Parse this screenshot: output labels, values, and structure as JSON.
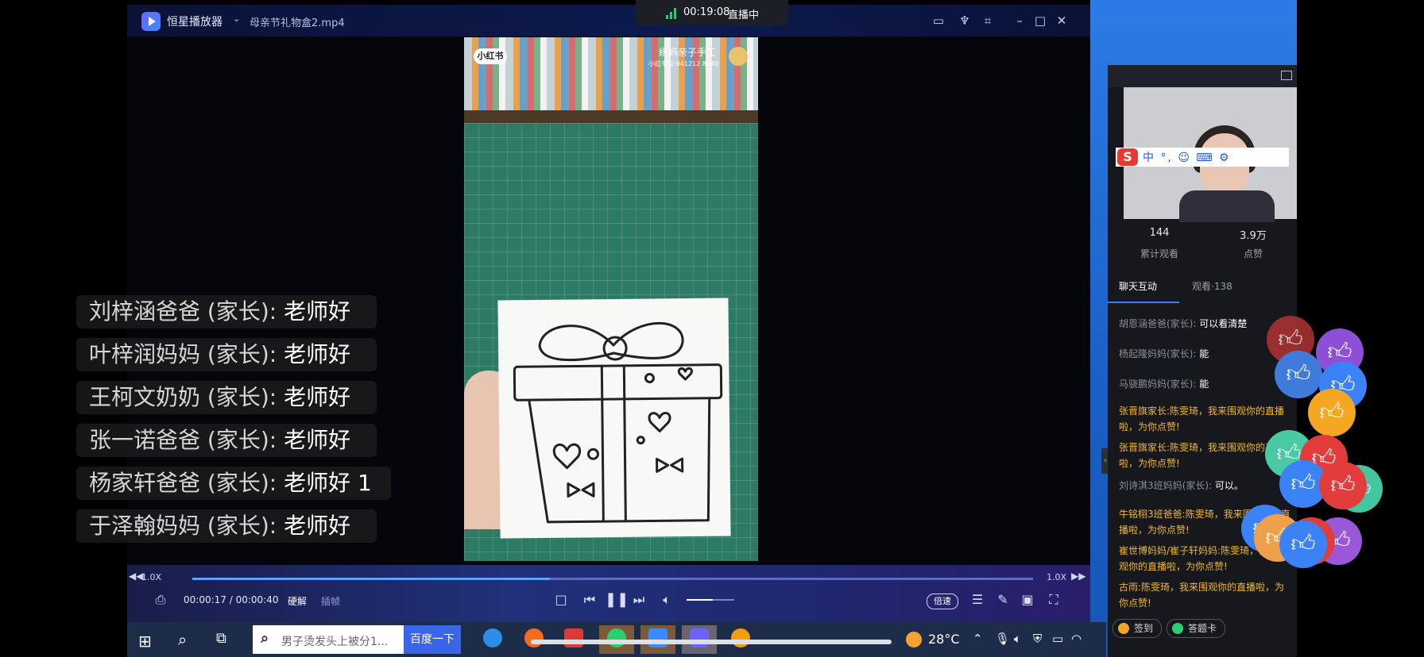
{
  "player": {
    "app_name": "恒星播放器",
    "file_name": "母亲节礼物盒2.mp4",
    "speed_left": "1.0X",
    "speed_right": "1.0X",
    "time": "00:00:17 / 00:00:40",
    "quality": "硬解",
    "plugin": "插帧",
    "rate_button": "倍速",
    "progress": 0.425,
    "volume": 0.55
  },
  "live_badge": {
    "time": "00:19:08",
    "label": "直播中"
  },
  "video": {
    "watermark_logo": "小红书",
    "watermark_name": "缘妈亲子手工",
    "watermark_id": "小红书号:941212 8840"
  },
  "danmaku": [
    {
      "who": "刘梓涵爸爸 (家长): ",
      "text": "老师好"
    },
    {
      "who": "叶梓润妈妈 (家长): ",
      "text": "老师好"
    },
    {
      "who": "王柯文奶奶 (家长): ",
      "text": "老师好"
    },
    {
      "who": "张一诺爸爸 (家长): ",
      "text": "老师好"
    },
    {
      "who": "杨家轩爸爸 (家长): ",
      "text": "老师好 1"
    },
    {
      "who": "于泽翰妈妈 (家长): ",
      "text": "老师好"
    }
  ],
  "ime": {
    "text": "中 °, ☺ ⌨ ⚙"
  },
  "stats": {
    "views": "144",
    "views_label": "累计观看",
    "likes": "3.9万",
    "likes_label": "点赞"
  },
  "tabs": {
    "chat": "聊天互动",
    "watch": "观看·138"
  },
  "chat": [
    {
      "name": "胡恩涵爸爸(家长):",
      "text": "可以看清楚",
      "hl": false
    },
    {
      "name": "杨起隆妈妈(家长):",
      "text": "能",
      "hl": false
    },
    {
      "name": "马骁鹏妈妈(家长):",
      "text": "能",
      "hl": false
    },
    {
      "name": "张晋旗家长:",
      "text": "陈雯琦，我来围观你的直播啦，为你点赞!",
      "hl": true
    },
    {
      "name": "张晋旗家长:",
      "text": "陈雯琦，我来围观你的直播啦，为你点赞!",
      "hl": true
    },
    {
      "name": "刘诗淇3班妈妈(家长):",
      "text": "可以。",
      "hl": false
    },
    {
      "name": "牛铭栩3班爸爸:",
      "text": "陈雯琦，我来围观你的直播啦，为你点赞!",
      "hl": true
    },
    {
      "name": "崔世博妈妈/崔子轩妈妈:",
      "text": "陈雯琦，我来围观你的直播啦，为你点赞!",
      "hl": true
    },
    {
      "name": "古雨:",
      "text": "陈雯琦，我来围观你的直播啦，为你点赞!",
      "hl": true
    }
  ],
  "buttons": {
    "signin": "签到",
    "answer_card": "答题卡"
  },
  "taskbar": {
    "search_text": "男子烫发头上被分1...",
    "search_button": "百度一下",
    "temperature": "28°C"
  },
  "colors": {
    "accent": "#3e7bff",
    "highlight_chat": "#f0b730",
    "like_blue": "#3b82f6"
  }
}
